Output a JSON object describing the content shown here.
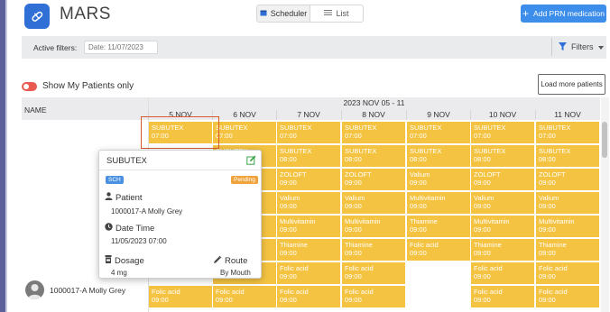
{
  "app": {
    "title": "MARS",
    "view_tabs": [
      {
        "label": "Scheduler",
        "active": true
      },
      {
        "label": "List",
        "active": false
      }
    ],
    "add_button_label": "Add PRN medication",
    "accent_color": "#3d8eea"
  },
  "filters": {
    "active_label": "Active filters:",
    "date_placeholder": "Date: 11/07/2023",
    "filters_label": "Filters"
  },
  "toggle": {
    "label": "Show My Patients only",
    "on": false
  },
  "load_more_label": "Load more patients",
  "table": {
    "name_header": "NAME",
    "week_label": "2023 NOV 05 - 11",
    "days": [
      "5 NOV",
      "6 NOV",
      "7 NOV",
      "8 NOV",
      "9 NOV",
      "10 NOV",
      "11 NOV"
    ],
    "patient": "1000017-A Molly Grey",
    "cell_color": "#f4c342",
    "rows": [
      [
        "SUBUTEX|07:00",
        "SUBUTEX|07:00",
        "SUBUTEX|07:00",
        "SUBUTEX|07:00",
        "SUBUTEX|07:00",
        "SUBUTEX|07:00",
        "SUBUTEX|07:00"
      ],
      [
        "",
        "SUBUTEX|08:00",
        "SUBUTEX|08:00",
        "SUBUTEX|08:00",
        "SUBUTEX|08:00",
        "SUBUTEX|08:00",
        "SUBUTEX|08:00"
      ],
      [
        "",
        "ZOLOFT|09:00",
        "ZOLOFT|09:00",
        "ZOLOFT|09:00",
        "Valium|09:00",
        "ZOLOFT|09:00",
        "ZOLOFT|09:00"
      ],
      [
        "",
        "Valium|09:00",
        "Valium|09:00",
        "Valium|09:00",
        "Multivitamin|09:00",
        "Valium|09:00",
        "Valium|09:00"
      ],
      [
        "",
        "Multivitamin|09:00",
        "Multivitamin|09:00",
        "Multivitamin|09:00",
        "Thiamine|09:00",
        "Multivitamin|09:00",
        "Multivitamin|09:00"
      ],
      [
        "",
        "Thiamine|09:00",
        "Thiamine|09:00",
        "Thiamine|09:00",
        "Folic acid|09:00",
        "Thiamine|09:00",
        "Thiamine|09:00"
      ],
      [
        "",
        "Folic acid|09:00",
        "Folic acid|09:00",
        "Folic acid|09:00",
        "",
        "Folic acid|09:00",
        "Folic acid|09:00"
      ],
      [
        "Folic acid|09:00",
        "Folic acid|09:00",
        "Folic acid|09:00",
        "Folic acid|09:00",
        "",
        "Folic acid|09:00",
        "Folic acid|09:00"
      ]
    ]
  },
  "popup": {
    "title": "SUBUTEX",
    "badge_type": "SCH",
    "badge_status": "Pending",
    "patient_label": "Patient",
    "patient_value": "1000017-A Molly Grey",
    "datetime_label": "Date Time",
    "datetime_value": "11/05/2023 07:00",
    "dosage_label": "Dosage",
    "dosage_value": "4 mg",
    "route_label": "Route",
    "route_value": "By Mouth"
  }
}
